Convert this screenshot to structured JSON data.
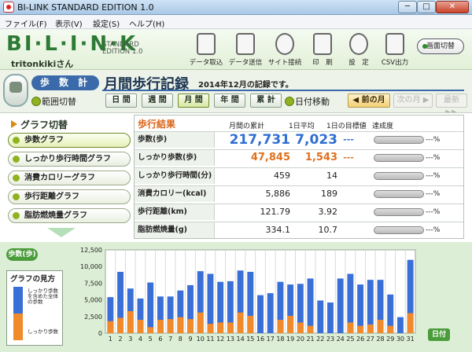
{
  "window": {
    "title": "BI-LINK STANDARD EDITION 1.0",
    "min": "─",
    "max": "□",
    "close": "✕"
  },
  "menu": [
    "ファイル(F)",
    "表示(V)",
    "設定(S)",
    "ヘルプ(H)"
  ],
  "header": {
    "logo": "BI·L·I·N·K",
    "edition_line1": "STANDARD",
    "edition_line2": "EDITION 1.0",
    "user": "tritonkikiさん",
    "tools": [
      {
        "label": "データ取込",
        "icon": "import-icon"
      },
      {
        "label": "データ送信",
        "icon": "send-icon"
      },
      {
        "label": "サイト接続",
        "icon": "globe-icon"
      },
      {
        "label": "印　刷",
        "icon": "printer-icon"
      },
      {
        "label": "設　定",
        "icon": "settings-icon"
      },
      {
        "label": "CSV出力",
        "icon": "csv-icon"
      }
    ],
    "screen_switch": "画面切替"
  },
  "sub": {
    "tag": "歩 数 計",
    "title": "月間歩行記録",
    "record_note": "2014年12月の記録です。",
    "range_label": "範囲切替",
    "range_buttons": [
      "日 間",
      "週 間",
      "月 間",
      "年 間",
      "累 計"
    ],
    "range_selected": 2,
    "datenav_label": "日付移動",
    "prev_month": "◀ 前の月",
    "next_month": "次の月 ▶",
    "latest": "最新 ▶▶"
  },
  "graph_switch": {
    "title": "グラフ切替",
    "items": [
      "歩数グラフ",
      "しっかり歩行時間グラフ",
      "消費カロリーグラフ",
      "歩行距離グラフ",
      "脂肪燃焼量グラフ"
    ],
    "selected": 0
  },
  "results": {
    "title": "歩行結果",
    "headers": [
      "月間の累計",
      "1日平均",
      "1日の目標値",
      "達成度"
    ],
    "rows": [
      {
        "label": "歩数(歩)",
        "total": "217,731",
        "avg": "7,023",
        "target": "---",
        "pct": "---%",
        "color": "#2f6fd2",
        "style": "big",
        "dash_color": "#2f6fd2"
      },
      {
        "label": "しっかり歩数(歩)",
        "total": "47,845",
        "avg": "1,543",
        "target": "---",
        "pct": "---%",
        "color": "#e0701c",
        "style": "big2",
        "dash_color": "#e0701c"
      },
      {
        "label": "しっかり歩行時間(分)",
        "total": "459",
        "avg": "14",
        "target": "",
        "pct": "---%",
        "color": "#222",
        "style": "",
        "dash_color": "#222"
      },
      {
        "label": "消費カロリー(kcal)",
        "total": "5,886",
        "avg": "189",
        "target": "",
        "pct": "---%",
        "color": "#222",
        "style": "",
        "dash_color": "#222"
      },
      {
        "label": "歩行距離(km)",
        "total": "121.79",
        "avg": "3.92",
        "target": "",
        "pct": "---%",
        "color": "#222",
        "style": "",
        "dash_color": "#222"
      },
      {
        "label": "脂肪燃焼量(g)",
        "total": "334.1",
        "avg": "10.7",
        "target": "",
        "pct": "---%",
        "color": "#222",
        "style": "",
        "dash_color": "#222"
      }
    ]
  },
  "chart_panel": {
    "steps_tag": "歩数(歩)",
    "guide_title": "グラフの見方",
    "guide_text1": "しっかり歩数を含めた全体の歩数",
    "guide_text2": "しっかり歩数",
    "date_button": "日付"
  },
  "chart_data": {
    "type": "bar",
    "stacked": true,
    "categories": [
      "1",
      "2",
      "3",
      "4",
      "5",
      "6",
      "7",
      "8",
      "9",
      "10",
      "11",
      "12",
      "13",
      "14",
      "15",
      "16",
      "17",
      "18",
      "19",
      "20",
      "21",
      "22",
      "23",
      "24",
      "25",
      "26",
      "27",
      "28",
      "29",
      "30",
      "31"
    ],
    "series": [
      {
        "name": "しっかり歩数",
        "color": "#f08a2a",
        "values": [
          1800,
          2300,
          3300,
          2000,
          900,
          2000,
          2100,
          2400,
          2100,
          3100,
          1400,
          1600,
          1600,
          3100,
          2600,
          0,
          0,
          2000,
          2600,
          1600,
          1100,
          0,
          0,
          0,
          1600,
          1100,
          1300,
          2000,
          1100,
          0,
          3000
        ]
      },
      {
        "name": "歩数",
        "color": "#3a6fd8",
        "values": [
          5400,
          9200,
          6700,
          5200,
          7600,
          5500,
          5500,
          6400,
          7200,
          9300,
          8900,
          7700,
          7800,
          9400,
          9200,
          5700,
          6000,
          7700,
          7300,
          7400,
          8200,
          4900,
          4600,
          8200,
          8900,
          7300,
          8000,
          8000,
          5800,
          2400,
          11000
        ]
      }
    ],
    "note": "blue bar height = total steps (歩数); orange segment = しっかり歩数 portion",
    "ylim": [
      0,
      12500
    ],
    "yticks": [
      "0",
      "2,500",
      "5,000",
      "7,500",
      "10,000",
      "12,500"
    ],
    "grid": true
  }
}
